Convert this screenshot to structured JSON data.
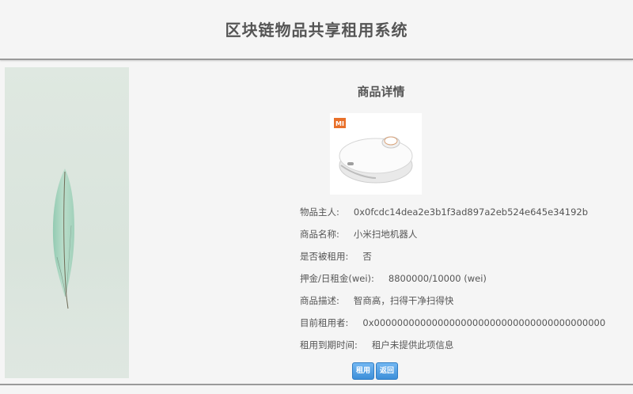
{
  "header": {
    "title": "区块链物品共享租用系统"
  },
  "detail": {
    "section_title": "商品详情",
    "image_brand": "MI",
    "rows": [
      {
        "label": "物品主人:",
        "value": "0x0fcdc14dea2e3b1f3ad897a2eb524e645e34192b"
      },
      {
        "label": "商品名称:",
        "value": "小米扫地机器人"
      },
      {
        "label": "是否被租用:",
        "value": "否"
      },
      {
        "label": "押金/日租金(wei):",
        "value": "8800000/10000 (wei)"
      },
      {
        "label": "商品描述:",
        "value": "智商高，扫得干净扫得快"
      },
      {
        "label": "目前租用者:",
        "value": "0x0000000000000000000000000000000000000000"
      },
      {
        "label": "租用到期时间:",
        "value": "租户未提供此项信息"
      }
    ]
  },
  "actions": {
    "rent_label": "租用",
    "back_label": "返回"
  },
  "colors": {
    "accent": "#3d8fd9",
    "text": "#555555",
    "brand_mi": "#e8702a"
  }
}
